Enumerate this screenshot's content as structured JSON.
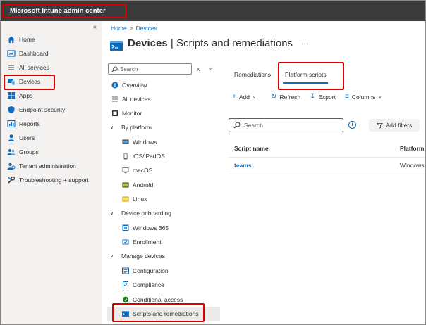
{
  "topbar": {
    "title": "Microsoft Intune admin center"
  },
  "leftnav": {
    "collapse": "«",
    "items": [
      {
        "label": "Home",
        "icon": "home-icon",
        "color": "#0f6cbd"
      },
      {
        "label": "Dashboard",
        "icon": "dashboard-icon",
        "color": "#0f6cbd"
      },
      {
        "label": "All services",
        "icon": "list-icon",
        "color": "#605e5c"
      },
      {
        "label": "Devices",
        "icon": "devices-icon",
        "color": "#0f6cbd"
      },
      {
        "label": "Apps",
        "icon": "apps-icon",
        "color": "#0f6cbd"
      },
      {
        "label": "Endpoint security",
        "icon": "shield-icon",
        "color": "#0f6cbd"
      },
      {
        "label": "Reports",
        "icon": "reports-icon",
        "color": "#0f6cbd"
      },
      {
        "label": "Users",
        "icon": "users-icon",
        "color": "#0f6cbd"
      },
      {
        "label": "Groups",
        "icon": "groups-icon",
        "color": "#0f6cbd"
      },
      {
        "label": "Tenant administration",
        "icon": "tenant-icon",
        "color": "#0f6cbd"
      },
      {
        "label": "Troubleshooting + support",
        "icon": "wrench-icon",
        "color": "#323130"
      }
    ]
  },
  "breadcrumb": {
    "home": "Home",
    "devices": "Devices",
    "sep": ">"
  },
  "page": {
    "title_bold": "Devices",
    "title_rest": " | Scripts and remediations",
    "more": "···"
  },
  "subnav": {
    "search_placeholder": "Search",
    "clear": "x",
    "collapse": "«",
    "overview": "Overview",
    "all_devices": "All devices",
    "monitor": "Monitor",
    "by_platform": "By platform",
    "windows": "Windows",
    "ios": "iOS/iPadOS",
    "macos": "macOS",
    "android": "Android",
    "linux": "Linux",
    "device_onboarding": "Device onboarding",
    "windows365": "Windows 365",
    "enrollment": "Enrollment",
    "manage_devices": "Manage devices",
    "configuration": "Configuration",
    "compliance": "Compliance",
    "conditional_access": "Conditional access",
    "scripts_remediations": "Scripts and remediations"
  },
  "tabs": {
    "remediations": "Remediations",
    "platform_scripts": "Platform scripts"
  },
  "toolbar": {
    "add": "Add",
    "refresh": "Refresh",
    "export": "Export",
    "columns": "Columns"
  },
  "filter": {
    "search_placeholder": "Search",
    "add_filters": "Add filters",
    "info": "i"
  },
  "table": {
    "headers": {
      "script_name": "Script name",
      "platform": "Platform"
    },
    "rows": [
      {
        "script_name": "teams",
        "platform": "Windows"
      }
    ]
  },
  "colors": {
    "accent": "#0f6cbd",
    "highlight": "#e00000",
    "topbar": "#3b3b3b"
  }
}
